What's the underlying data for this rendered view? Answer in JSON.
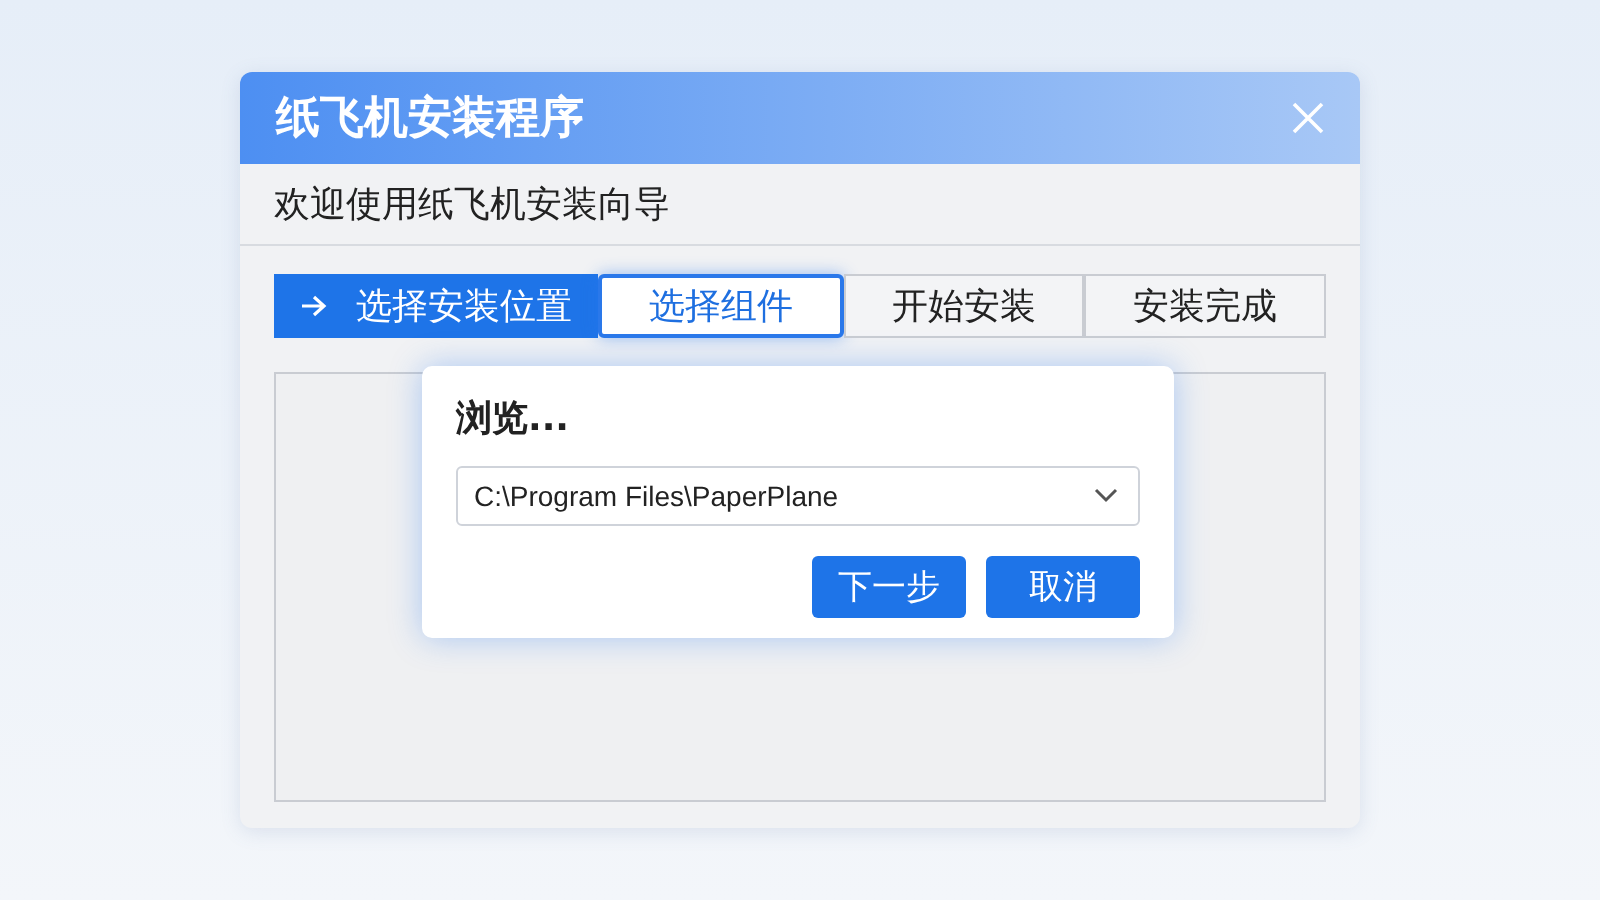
{
  "window": {
    "title": "纸飞机安装程序"
  },
  "subtitle": "欢迎使用纸飞机安装向导",
  "steps": [
    {
      "label": "选择安装位置",
      "completed": true,
      "selected": false
    },
    {
      "label": "选择组件",
      "completed": false,
      "selected": true
    },
    {
      "label": "开始安装",
      "completed": false,
      "selected": false
    },
    {
      "label": "安装完成",
      "completed": false,
      "selected": false
    }
  ],
  "dialog": {
    "title": "浏览...",
    "path": "C:\\Program Files\\PaperPlane",
    "buttons": [
      "下一步",
      "取消"
    ]
  }
}
